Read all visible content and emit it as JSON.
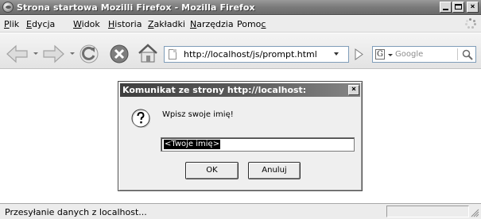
{
  "window": {
    "title": "Strona startowa Mozilli Firefox - Mozilla Firefox",
    "buttons": {
      "minimize": "",
      "maximize": "",
      "close": "×"
    }
  },
  "menu": [
    {
      "label_pre": "",
      "label_u": "P",
      "label_post": "lik"
    },
    {
      "label_pre": "",
      "label_u": "E",
      "label_post": "dycja"
    },
    {
      "label_pre": "",
      "label_u": "W",
      "label_post": "idok"
    },
    {
      "label_pre": "",
      "label_u": "H",
      "label_post": "istoria"
    },
    {
      "label_pre": "",
      "label_u": "Z",
      "label_post": "akładki"
    },
    {
      "label_pre": "",
      "label_u": "N",
      "label_post": "arzędzia"
    },
    {
      "label_pre": "Pomo",
      "label_u": "c",
      "label_post": ""
    }
  ],
  "toolbar": {
    "back_icon": "back-arrow-icon",
    "forward_icon": "forward-arrow-icon",
    "reload_icon": "reload-icon",
    "stop_icon": "stop-icon",
    "home_icon": "home-icon",
    "url": "http://localhost/js/prompt.html",
    "search_engine_letter": "G",
    "search_placeholder": "Google"
  },
  "dialog": {
    "title": "Komunikat ze strony http://localhost:",
    "close": "×",
    "message": "Wpisz swoje imię!",
    "input_value": "<Twoje imię>",
    "ok_label": "OK",
    "cancel_label": "Anuluj",
    "icon": "question-icon"
  },
  "status": {
    "text": "Przesyłanie danych z localhost..."
  }
}
